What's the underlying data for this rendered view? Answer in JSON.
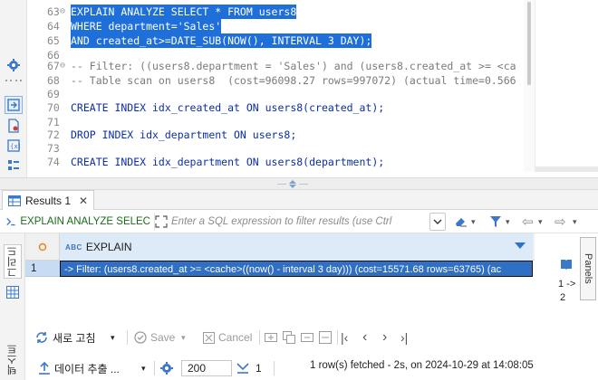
{
  "editor": {
    "lines": [
      {
        "num": "63",
        "fold": "⊖",
        "text": "EXPLAIN ANALYZE SELECT * FROM users8",
        "selected": true
      },
      {
        "num": "64",
        "fold": "",
        "text": "WHERE department='Sales'",
        "selected": true
      },
      {
        "num": "65",
        "fold": "",
        "text": "AND created_at>=DATE_SUB(NOW(), INTERVAL 3 DAY);",
        "selected": true
      },
      {
        "num": "66",
        "fold": "",
        "text": "",
        "selected": false
      },
      {
        "num": "67",
        "fold": "⊖",
        "text": "-- Filter: ((users8.department = 'Sales') and (users8.created_at >= <ca",
        "selected": false
      },
      {
        "num": "68",
        "fold": "",
        "text": "-- Table scan on users8  (cost=96098.27 rows=997072) (actual time=0.566",
        "selected": false
      },
      {
        "num": "69",
        "fold": "",
        "text": "",
        "selected": false
      },
      {
        "num": "70",
        "fold": "",
        "text": "CREATE INDEX idx_created_at ON users8(created_at);",
        "selected": false
      },
      {
        "num": "71",
        "fold": "",
        "text": "",
        "selected": false
      },
      {
        "num": "72",
        "fold": "",
        "text": "DROP INDEX idx_department ON users8;",
        "selected": false
      },
      {
        "num": "73",
        "fold": "",
        "text": "",
        "selected": false
      },
      {
        "num": "74",
        "fold": "",
        "text": "CREATE INDEX idx_department ON users8(department);",
        "selected": false
      }
    ]
  },
  "results": {
    "tab_label": "Results 1",
    "tab_close": "✕",
    "filter_query": "EXPLAIN ANALYZE SELEC",
    "filter_placeholder": "Enter a SQL expression to filter results (use Ctrl",
    "column_header": "EXPLAIN",
    "column_type_badge": "ABC",
    "row_number": "1",
    "row_value": "-> Filter: (users8.created_at >= <cache>((now() - interval 3 day)))  (cost=15571.68 rows=63765) (ac",
    "side_tabs": {
      "grid": "그리드",
      "text": "텍스트"
    },
    "panels_label": "Panels",
    "side_values": [
      "1 ->",
      "2"
    ]
  },
  "bottom_bar": {
    "refresh_label": "새로 고침",
    "save_label": "Save",
    "cancel_label": "Cancel",
    "export_label": "데이터 추출 ...",
    "max_rows": "200",
    "fetched_count": "1",
    "status": "1 row(s) fetched - 2s, on 2024-10-29 at 14:08:05"
  },
  "colors": {
    "selection": "#1e6fd9",
    "keyword": "#0b2fa8",
    "comment": "#7a7a7a",
    "accent": "#2f73c9",
    "grid_cell_selected": "#2f6fc4"
  }
}
